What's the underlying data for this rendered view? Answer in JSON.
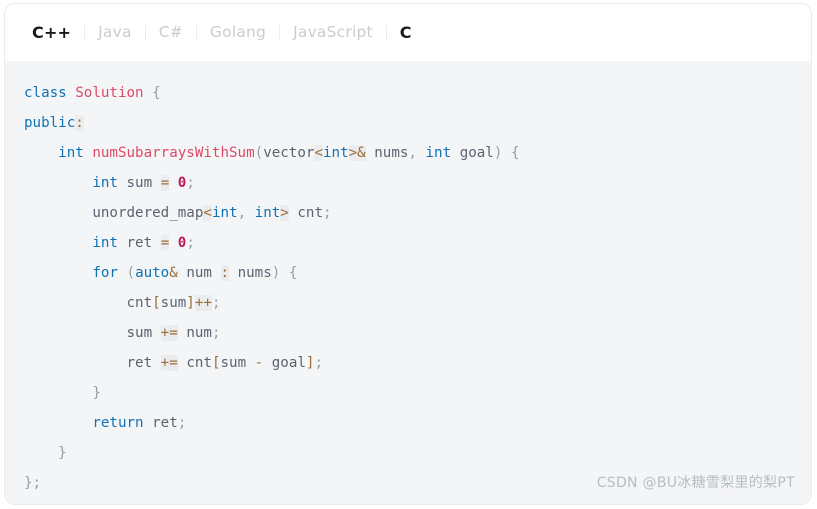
{
  "card": {
    "background_color": "#ffffff",
    "code_background_color": "#f4f5f7",
    "border_color": "#e9ecef"
  },
  "tabs": {
    "items": [
      {
        "label": "C++",
        "active": true
      },
      {
        "label": "Java",
        "active": false
      },
      {
        "label": "C#",
        "active": false
      },
      {
        "label": "Golang",
        "active": false
      },
      {
        "label": "JavaScript",
        "active": false
      },
      {
        "label": "C",
        "active": true
      }
    ],
    "active_color": "#1a1a1a",
    "inactive_color": "#c9ccd1",
    "separator_color": "#ebecef"
  },
  "code": {
    "language": "C++",
    "theme_colors": {
      "keyword": "#0e72b5",
      "class_name": "#dd4a68",
      "number": "#c2185b",
      "operator": "#9a6e3a",
      "operator_background": "#ebecee",
      "punctuation": "#999da3",
      "plain": "#5c6370"
    },
    "lines": [
      "class Solution {",
      "public:",
      "    int numSubarraysWithSum(vector<int>& nums, int goal) {",
      "        int sum = 0;",
      "        unordered_map<int, int> cnt;",
      "        int ret = 0;",
      "        for (auto& num : nums) {",
      "            cnt[sum]++;",
      "            sum += num;",
      "            ret += cnt[sum - goal];",
      "        }",
      "        return ret;",
      "    }",
      "};"
    ]
  },
  "watermark": {
    "text": "CSDN @BU冰糖雪梨里的梨PT",
    "color": "#b9bcc2"
  }
}
